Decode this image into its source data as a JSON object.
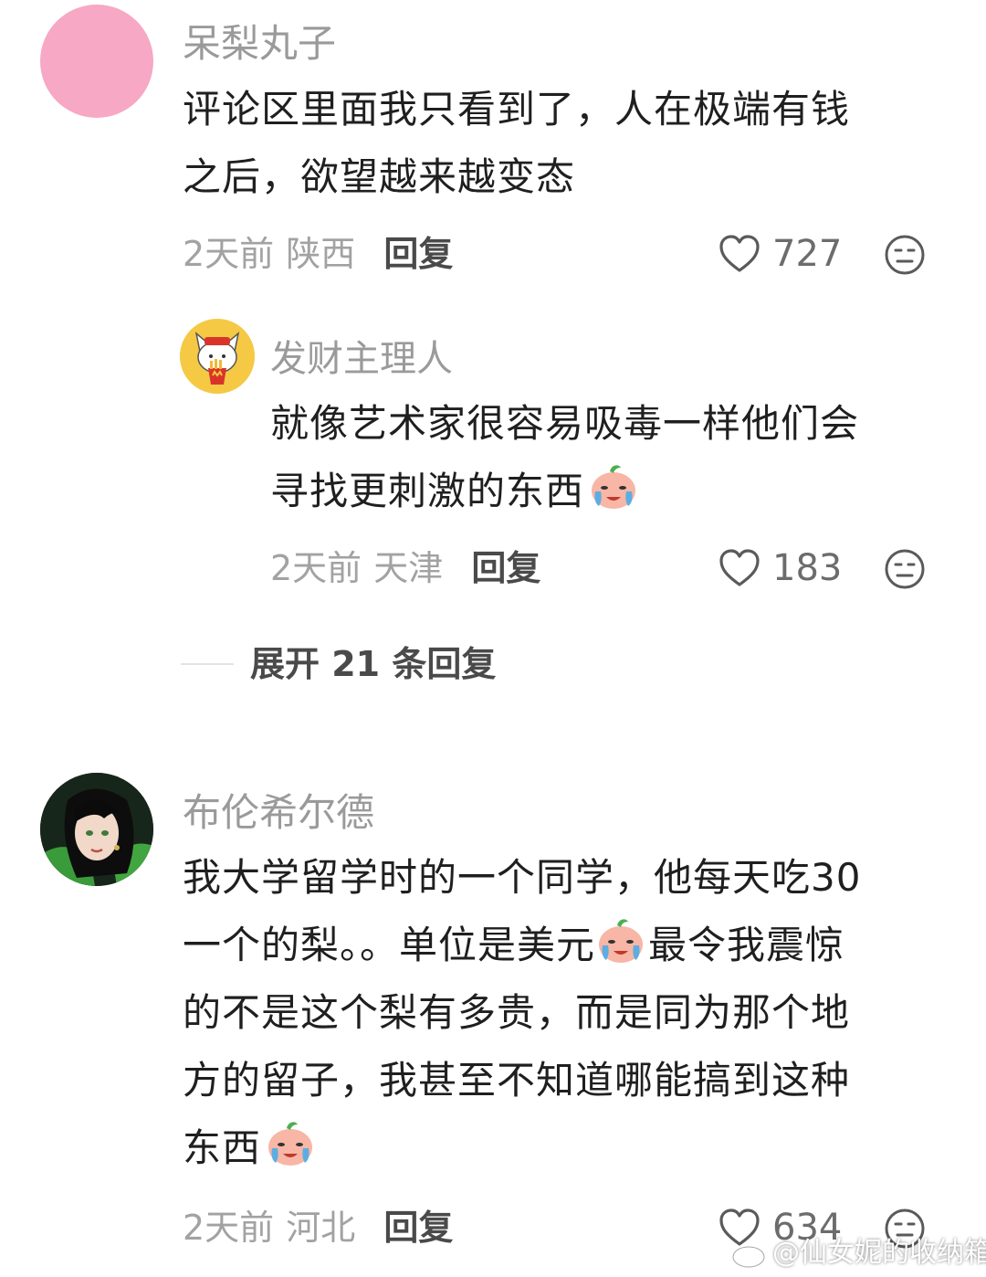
{
  "comments": [
    {
      "username": "呆梨丸子",
      "avatar_color": "#f7a8c4",
      "lines": [
        "评论区里面我只看到了，人在极端有钱",
        "之后，欲望越来越变态"
      ],
      "time": "2天前",
      "location": "陕西",
      "reply_label": "回复",
      "likes": "727",
      "replies": [
        {
          "username": "发财主理人",
          "lines": [
            "就像艺术家很容易吸毒一样他们会",
            "寻找更刺激的东西"
          ],
          "emoji": "crying-peach-emoji",
          "time": "2天前",
          "location": "天津",
          "reply_label": "回复",
          "likes": "183"
        }
      ],
      "expand_label": "展开 21 条回复"
    },
    {
      "username": "布伦希尔德",
      "lines": [
        "我大学留学时的一个同学，他每天吃30",
        "一个的梨。。单位是美元",
        "最令我震惊",
        "的不是这个梨有多贵，而是同为那个地",
        "方的留子，我甚至不知道哪能搞到这种",
        "东西"
      ],
      "time": "2天前",
      "location": "河北",
      "reply_label": "回复",
      "likes": "634"
    }
  ],
  "icons": {
    "like": "heart-outline-icon",
    "dislike": "unamused-face-icon",
    "emoji": "crying-peach-emoji"
  },
  "watermark": "@仙女妮的收纳箱"
}
